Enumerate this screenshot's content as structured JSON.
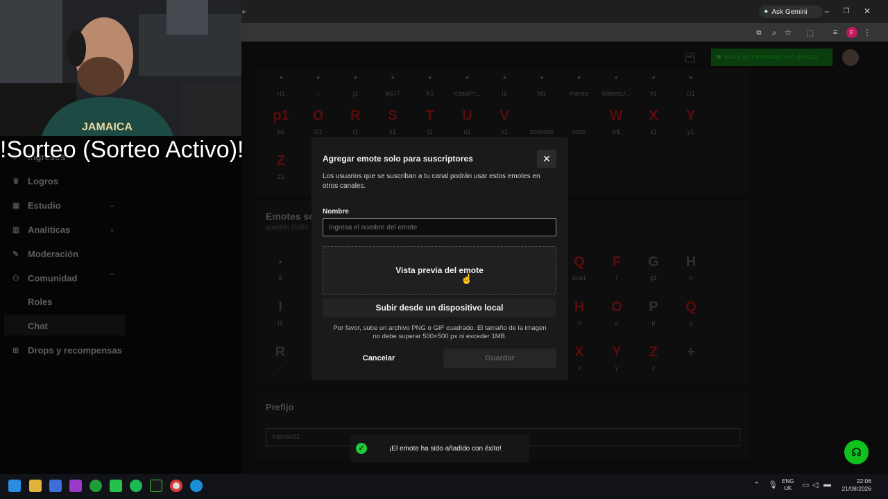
{
  "browser": {
    "gemini_label": "Ask Gemini",
    "profile_initial": "F"
  },
  "header": {
    "start_stream_label": "Inicia la transmisión en directo"
  },
  "emote_grid_top": {
    "row1_labels": [
      "H1",
      "i",
      "j1",
      "jii677",
      "K1",
      "KasioPr...",
      "l1",
      "M1",
      "manza",
      "ManzaU...",
      "n1",
      "O1"
    ],
    "row2_glyphs": [
      "p1",
      "O",
      "R",
      "S",
      "T",
      "U",
      "V",
      "",
      "",
      "W",
      "X",
      "Y"
    ],
    "row2_labels": [
      "p1",
      "O1",
      "r1",
      "s1",
      "t1",
      "u1",
      "v1",
      "zmibado",
      "voss",
      "w1",
      "x1",
      "y1"
    ],
    "row3_glyph": "Z",
    "row3_label": "z1"
  },
  "subscriber_section": {
    "title": "Emotes so",
    "subtitle": "quedan 25/60",
    "row1_glyphs": [
      "",
      "Q",
      "F",
      "G",
      "H"
    ],
    "row1_labels": [
      "ß",
      "ene1",
      "f",
      "g1",
      "h"
    ],
    "row2_glyphs": [
      "I",
      "H",
      "O",
      "P",
      "Q"
    ],
    "row2_labels": [
      "i1",
      "n",
      "o",
      "p",
      "q"
    ],
    "row3_glyphs": [
      "R",
      "X",
      "Y",
      "Z",
      "+"
    ],
    "row3_labels": [
      "r",
      "x",
      "y",
      "z",
      ""
    ]
  },
  "prefix_section": {
    "title": "Prefijo",
    "value": "kasiox01"
  },
  "sidebar": {
    "items": [
      {
        "label": "Ingresos"
      },
      {
        "label": "Logros"
      },
      {
        "label": "Estudio"
      },
      {
        "label": "Analíticas"
      },
      {
        "label": "Moderación"
      },
      {
        "label": "Comunidad"
      },
      {
        "label": "Roles"
      },
      {
        "label": "Chat"
      },
      {
        "label": "Drops y recompensas"
      }
    ]
  },
  "overlay": {
    "text": "!Sorteo (Sorteo Activo)!",
    "cap_text": "JAMAICA"
  },
  "modal": {
    "title": "Agregar emote solo para suscriptores",
    "description": "Los usuarios que se suscriban a tu canal podrán usar estos emotes en otros canales.",
    "name_label": "Nombre",
    "name_placeholder": "Ingresa el nombre del emote",
    "preview_label": "Vista previa del emote",
    "upload_label": "Subir desde un dispositivo local",
    "help_text": "Por favor, sube un archivo PNG o GIF cuadrado. El tamaño de la imagen no debe superar 500×500 px ni exceder 1MB.",
    "cancel_label": "Cancelar",
    "save_label": "Guardar"
  },
  "toast": {
    "message": "¡El emote ha sido añadido con éxito!"
  },
  "taskbar": {
    "lang": "ENG",
    "region": "UK",
    "time": "22:06",
    "date": "21/08/2026"
  },
  "colors": {
    "accent_green": "#10c21c",
    "modal_bg": "#1a1a1a",
    "emote_red": "#5a0c0c"
  }
}
